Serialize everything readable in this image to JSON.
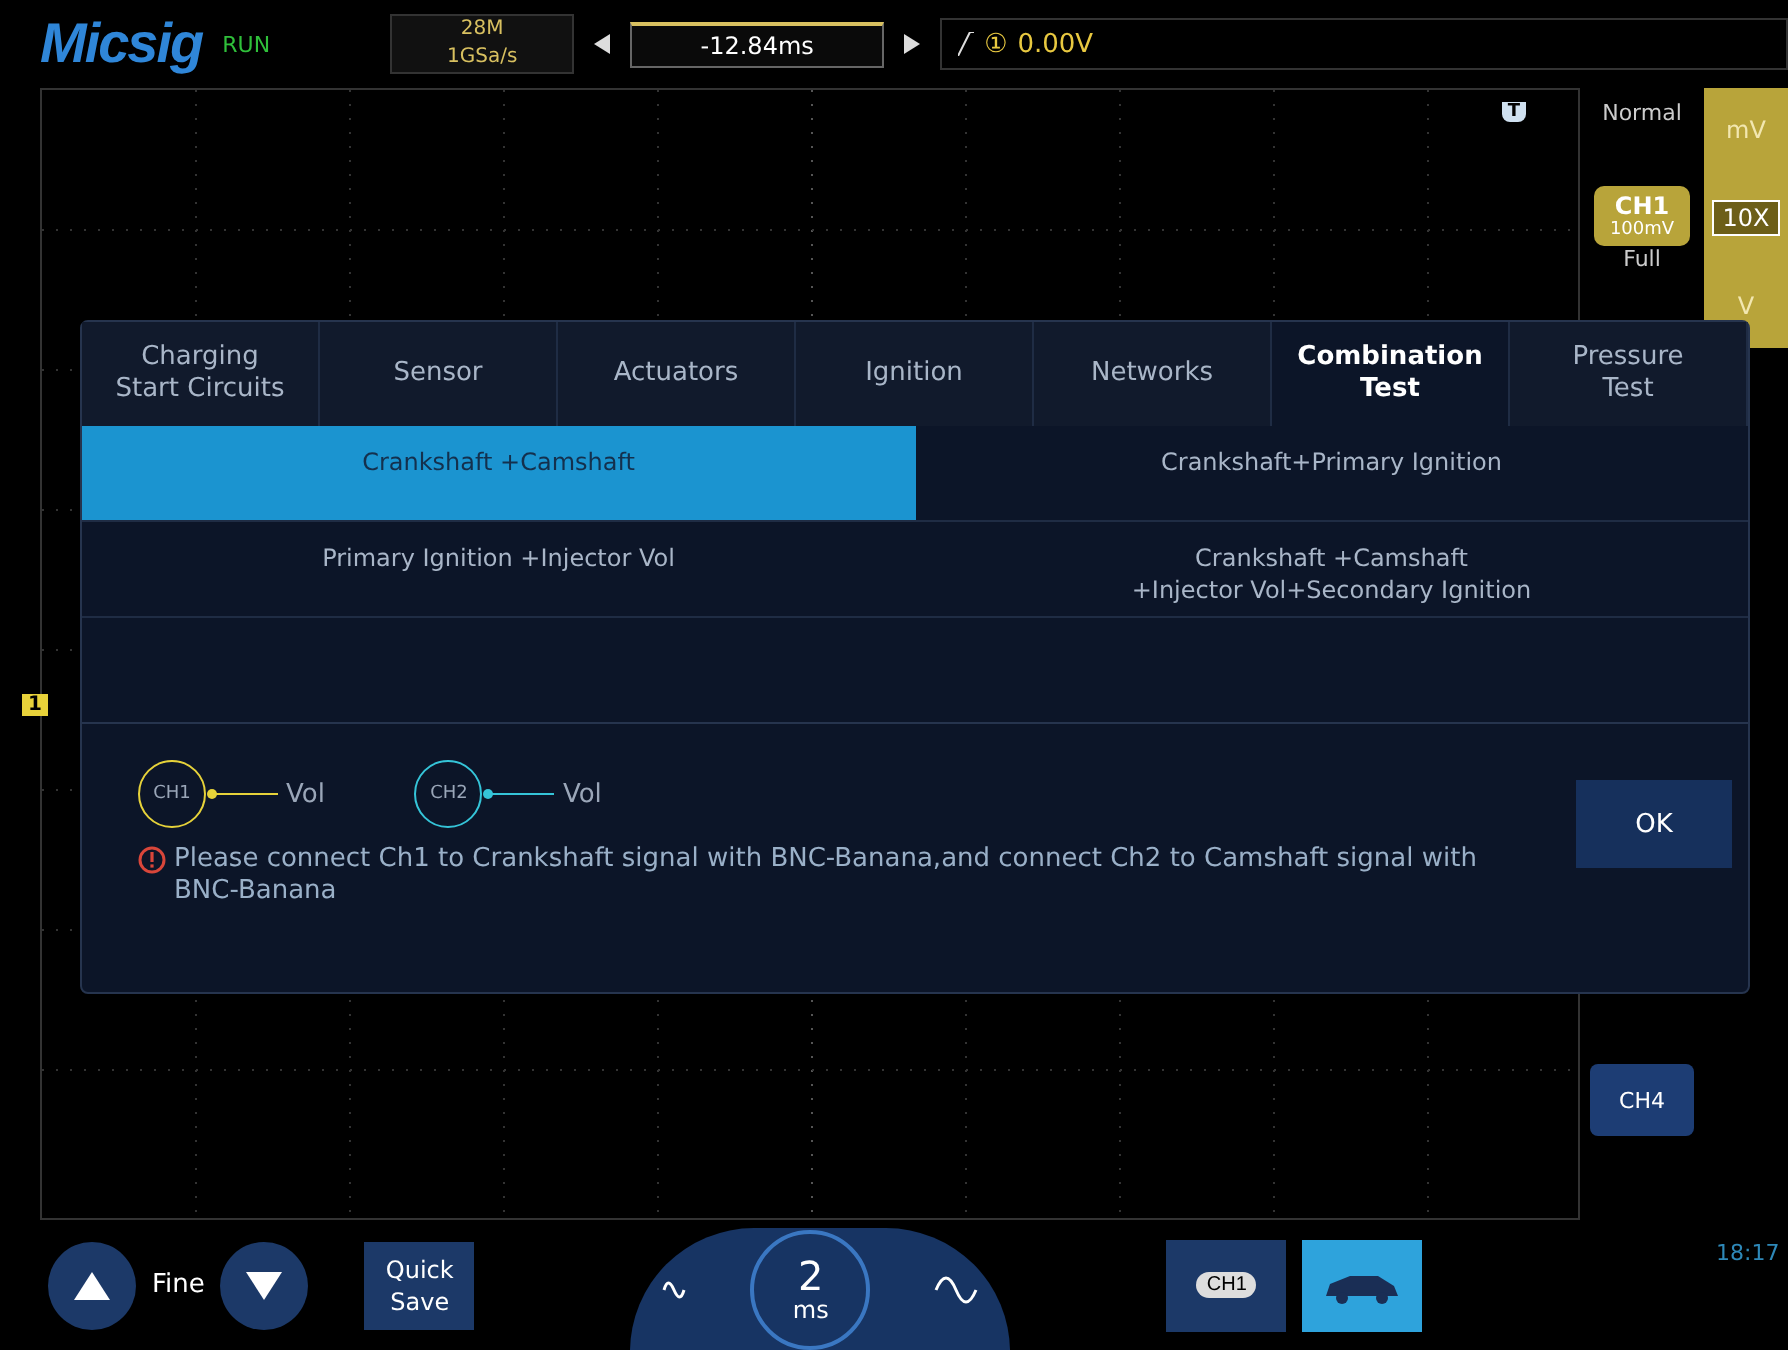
{
  "header": {
    "logo": "Micsig",
    "run_status": "RUN",
    "memory": "28M",
    "sample_rate": "1GSa/s",
    "time_offset": "-12.84ms",
    "trigger_source": "①",
    "trigger_level": "0.00V"
  },
  "markers": {
    "trigger": "T",
    "channel": "1"
  },
  "right_panel": {
    "trigger_mode": "Normal",
    "channel": {
      "label": "CH1",
      "scale": "100mV",
      "bandwidth": "Full"
    },
    "probe_units": [
      {
        "label": "mV",
        "selected": false
      },
      {
        "label": "10X",
        "selected": true
      },
      {
        "label": "V",
        "selected": false
      }
    ],
    "channel_button": "CH4"
  },
  "dialog": {
    "tabs": [
      {
        "label": "Charging\nStart Circuits",
        "selected": false
      },
      {
        "label": "Sensor",
        "selected": false
      },
      {
        "label": "Actuators",
        "selected": false
      },
      {
        "label": "Ignition",
        "selected": false
      },
      {
        "label": "Networks",
        "selected": false
      },
      {
        "label": "Combination\nTest",
        "selected": true
      },
      {
        "label": "Pressure\nTest",
        "selected": false
      }
    ],
    "options": [
      {
        "label": "Crankshaft +Camshaft",
        "selected": true
      },
      {
        "label": "Crankshaft+Primary Ignition",
        "selected": false
      },
      {
        "label": "Primary Ignition +Injector Vol",
        "selected": false
      },
      {
        "label": "Crankshaft +Camshaft\n+Injector Vol+Secondary Ignition",
        "selected": false
      }
    ],
    "probes": [
      {
        "channel": "CH1",
        "label": "Vol",
        "color": "#e6d23a"
      },
      {
        "channel": "CH2",
        "label": "Vol",
        "color": "#35c4d8"
      }
    ],
    "message": "Please connect Ch1 to Crankshaft signal with BNC-Banana,and connect Ch2 to Camshaft signal with BNC-Banana",
    "ok": "OK"
  },
  "bottom_bar": {
    "fine": "Fine",
    "quick_save": "Quick\nSave",
    "timebase_value": "2",
    "timebase_unit": "ms",
    "channel_button": "CH1",
    "car_mode_selected": true,
    "time": "18:17"
  }
}
